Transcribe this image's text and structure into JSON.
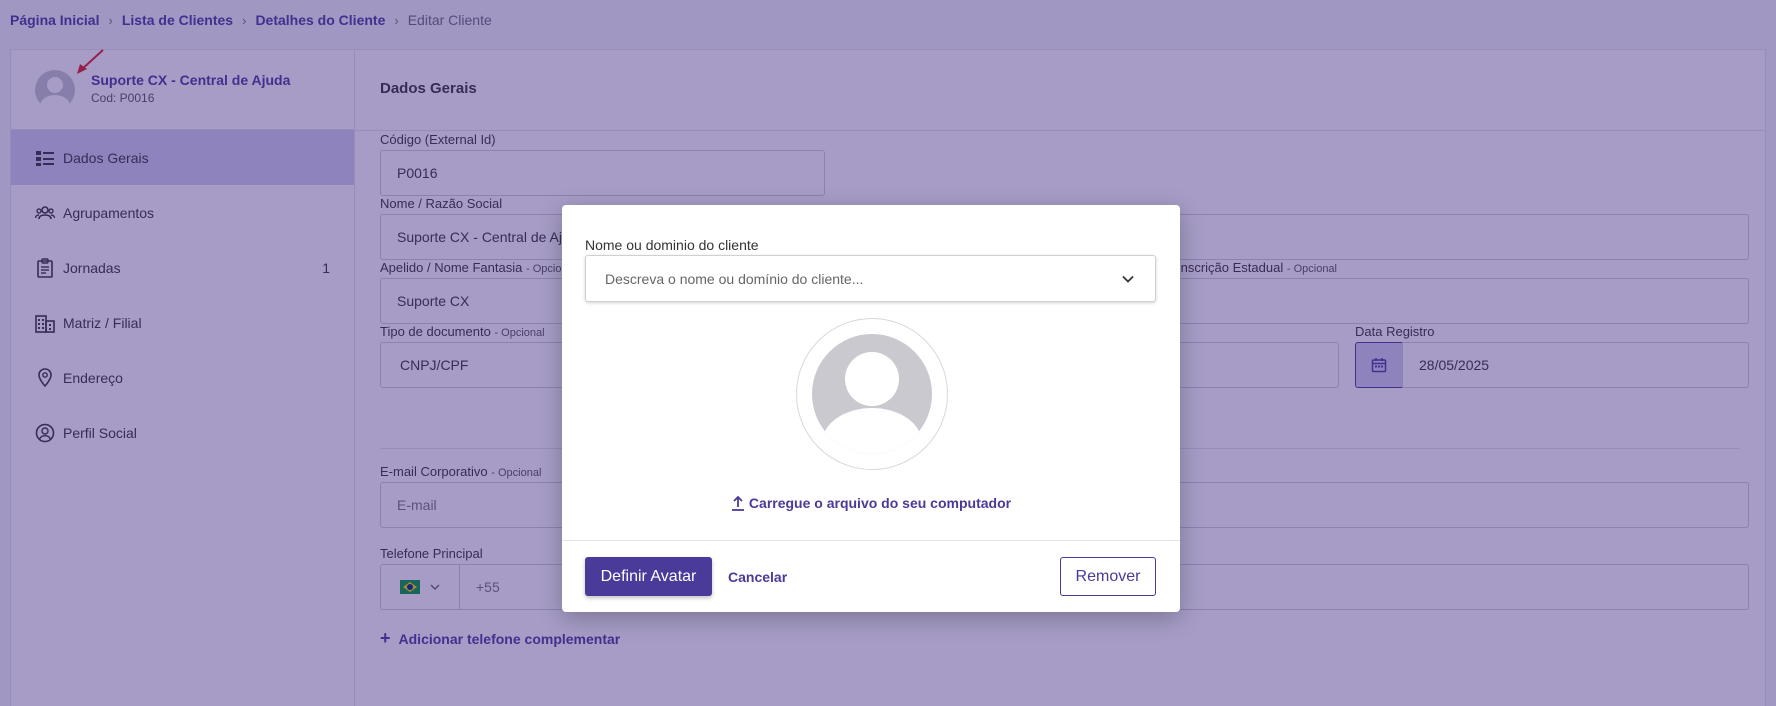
{
  "breadcrumb": {
    "items": [
      "Página Inicial",
      "Lista de Clientes",
      "Detalhes do Cliente"
    ],
    "current": "Editar Cliente",
    "separator": "›"
  },
  "sidebar": {
    "profile": {
      "name": "Suporte CX - Central de Ajuda",
      "code": "Cod: P0016"
    },
    "items": [
      {
        "label": "Dados Gerais",
        "icon": "list-icon",
        "active": true
      },
      {
        "label": "Agrupamentos",
        "icon": "group-icon"
      },
      {
        "label": "Jornadas",
        "icon": "clipboard-icon",
        "count": "1"
      },
      {
        "label": "Matriz / Filial",
        "icon": "building-icon"
      },
      {
        "label": "Endereço",
        "icon": "location-pin-icon"
      },
      {
        "label": "Perfil Social",
        "icon": "user-circle-icon"
      }
    ]
  },
  "content": {
    "title": "Dados Gerais",
    "optional_tag": "- Opcional",
    "fields": {
      "codigo": {
        "label": "Código (External Id)",
        "value": "P0016"
      },
      "nome": {
        "label": "Nome / Razão Social",
        "value": "Suporte CX - Central de Ajuda"
      },
      "apelido": {
        "label": "Apelido / Nome Fantasia",
        "value": "Suporte CX"
      },
      "inscricao": {
        "label": "Inscrição Estadual"
      },
      "tipo_doc": {
        "label": "Tipo de documento",
        "value": "CNPJ/CPF"
      },
      "data_registro": {
        "label": "Data Registro",
        "value": "28/05/2025"
      },
      "email": {
        "label": "E-mail Corporativo",
        "placeholder": "E-mail"
      },
      "telefone": {
        "label": "Telefone Principal",
        "prefix": "+55"
      }
    },
    "add_phone": "Adicionar telefone complementar"
  },
  "modal": {
    "label": "Nome ou dominio do cliente",
    "placeholder": "Descreva o nome ou domínio do cliente...",
    "upload": "Carregue o arquivo do seu computador",
    "primary": "Definir Avatar",
    "cancel": "Cancelar",
    "remove": "Remover"
  },
  "colors": {
    "accent": "#4a3a9a",
    "overlay": "#3a2480"
  }
}
